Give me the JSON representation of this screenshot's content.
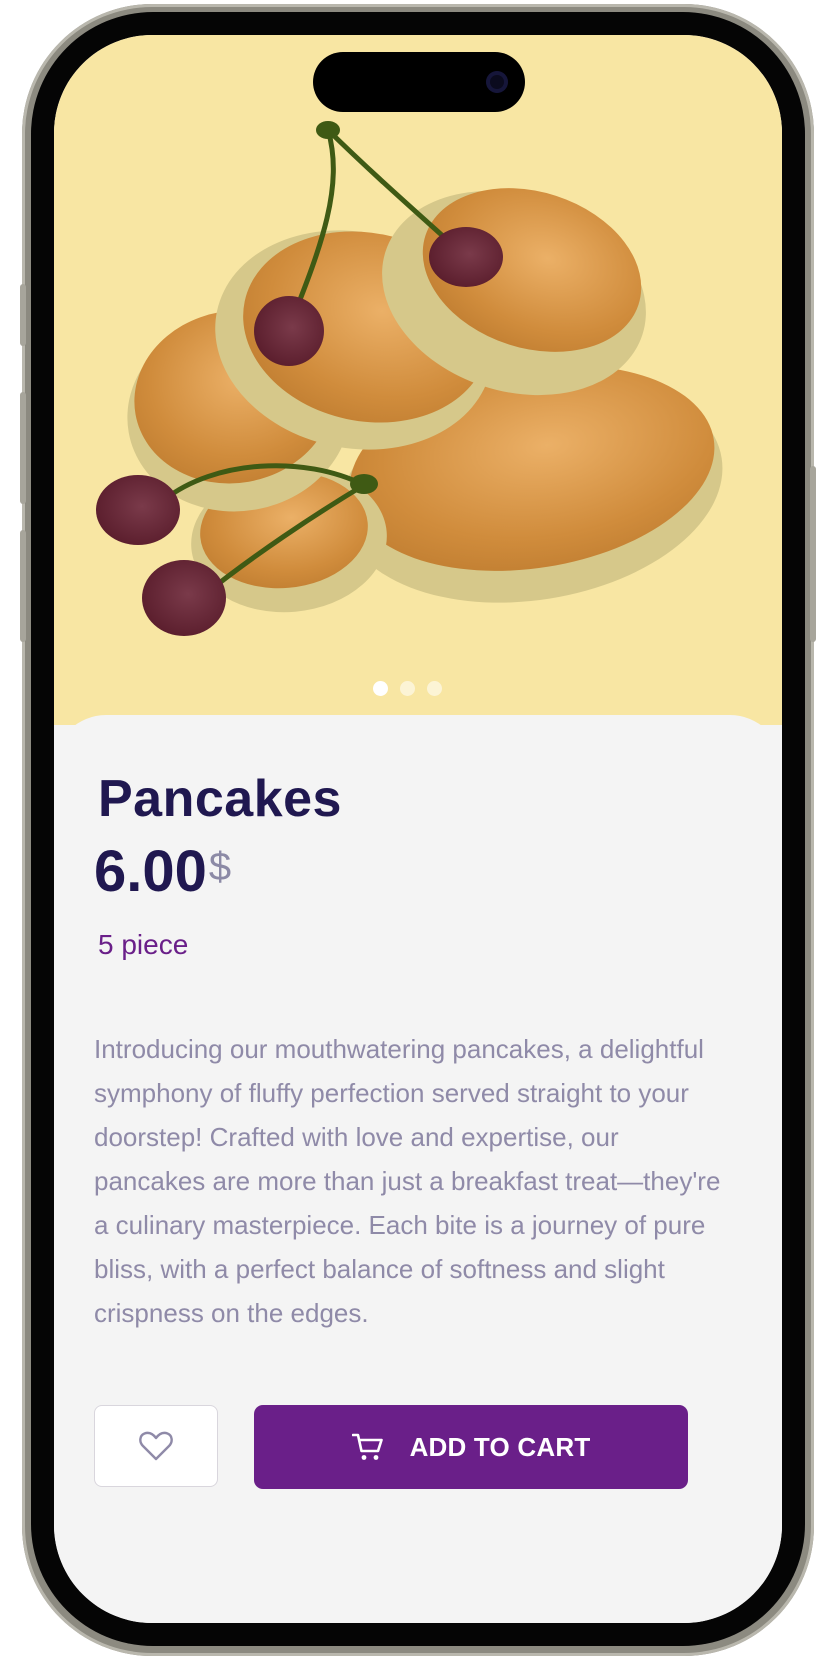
{
  "product": {
    "name": "Pancakes",
    "price": "6.00",
    "currency": "$",
    "quantity": "5 piece",
    "description": "Introducing our mouthwatering pancakes, a delightful symphony of fluffy perfection served straight to your doorstep! Crafted with love and expertise, our pancakes are more than just a breakfast treat—they're a culinary masterpiece. Each bite is a journey of pure bliss, with a perfect balance of softness and slight crispness on the edges.",
    "image_icon": "pancake-stack-with-cherries"
  },
  "carousel": {
    "slides": 3,
    "active": 1
  },
  "actions": {
    "favorite_icon": "heart-outline-icon",
    "cart_icon": "shopping-cart-icon",
    "add_to_cart_label": "ADD TO CART"
  },
  "colors": {
    "hero_background": "#f8e6a3",
    "sheet_background": "#f4f4f4",
    "title": "#201850",
    "accent": "#6a1f89",
    "muted_text": "#8f8aa8"
  }
}
